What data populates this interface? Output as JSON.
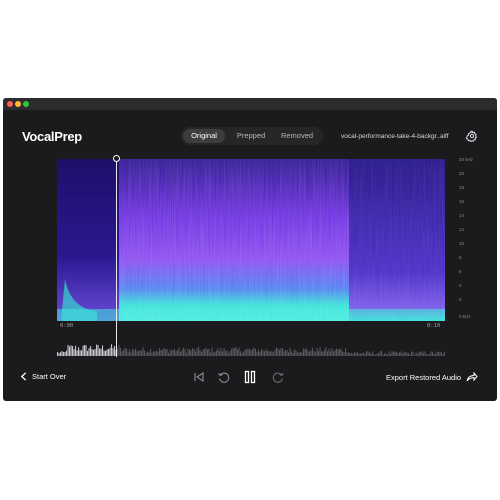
{
  "app": {
    "title": "VocalPrep"
  },
  "tabs": [
    {
      "label": "Original",
      "active": true
    },
    {
      "label": "Prepped",
      "active": false
    },
    {
      "label": "Removed",
      "active": false
    }
  ],
  "file": {
    "name": "vocal-performance-take-4-backgr..aiff"
  },
  "frequency_scale": {
    "labels": [
      "20 kHz",
      "20",
      "18",
      "16",
      "14",
      "12",
      "10",
      "8",
      "6",
      "4",
      "2",
      "0 kHz"
    ]
  },
  "timeline": {
    "start": "0:00",
    "end": "0:10"
  },
  "footer": {
    "start_over_label": "Start Over",
    "export_label": "Export Restored Audio"
  },
  "icons": {
    "back": "chevron-left-icon",
    "skip_back": "skip-back-icon",
    "rewind": "rewind-icon",
    "pause": "pause-icon",
    "forward": "forward-icon",
    "share": "share-icon",
    "settings": "gear-icon"
  },
  "colors": {
    "background": "#1b1b1d",
    "spectrogram_low": "#2ee6d6",
    "spectrogram_mid": "#7a35e8",
    "spectrogram_high": "#3b17b0"
  }
}
